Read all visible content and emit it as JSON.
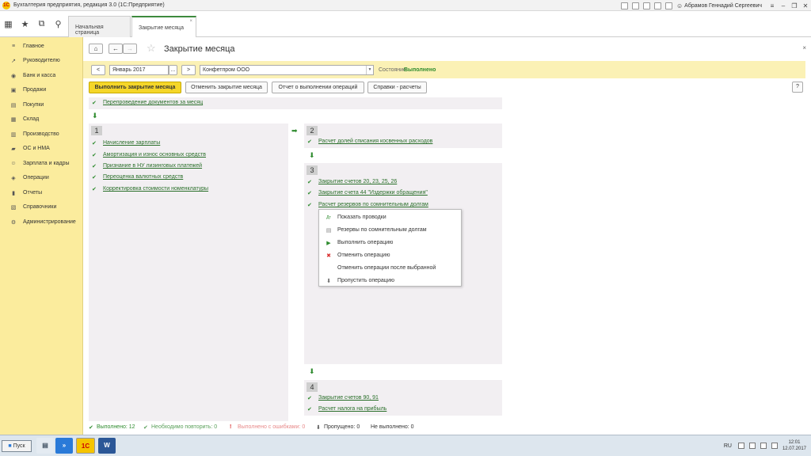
{
  "window": {
    "title": "Бухгалтерия предприятия, редакция 3.0  (1С:Предприятие)",
    "user": "Абрамов Геннадий Сергеевич"
  },
  "tabs": [
    {
      "label": "Начальная страница"
    },
    {
      "label": "Закрытие месяца",
      "close": "×"
    }
  ],
  "sidebar": {
    "items": [
      {
        "label": "Главное",
        "icon": "≡"
      },
      {
        "label": "Руководителю",
        "icon": "↗"
      },
      {
        "label": "Банк и касса",
        "icon": "◉"
      },
      {
        "label": "Продажи",
        "icon": "▣"
      },
      {
        "label": "Покупки",
        "icon": "▤"
      },
      {
        "label": "Склад",
        "icon": "▦"
      },
      {
        "label": "Производство",
        "icon": "▥"
      },
      {
        "label": "ОС и НМА",
        "icon": "▰"
      },
      {
        "label": "Зарплата и кадры",
        "icon": "☺"
      },
      {
        "label": "Операции",
        "icon": "◈"
      },
      {
        "label": "Отчеты",
        "icon": "▮"
      },
      {
        "label": "Справочники",
        "icon": "▧"
      },
      {
        "label": "Администрирование",
        "icon": "⚙"
      }
    ]
  },
  "page": {
    "title": "Закрытие месяца",
    "period": "Январь 2017",
    "organization": "Конфетпром ООО",
    "state_label": "Состояние:",
    "state_value": "Выполнено",
    "prev": "<",
    "next": ">",
    "ellipsis": "...",
    "close": "×",
    "help": "?"
  },
  "commands": {
    "execute": "Выполнить закрытие месяца",
    "cancel": "Отменить закрытие месяца",
    "report": "Отчет о выполнении операций",
    "references": "Справки - расчеты"
  },
  "top_operation": "Перепроведение документов за месяц",
  "stages": {
    "s1": {
      "number": "1",
      "items": [
        "Начисление зарплаты",
        "Амортизация и износ основных средств",
        "Признание в НУ лизинговых платежей",
        "Переоценка валютных средств",
        "Корректировка стоимости номенклатуры"
      ]
    },
    "s2": {
      "number": "2",
      "items": [
        "Расчет долей списания косвенных расходов"
      ]
    },
    "s3": {
      "number": "3",
      "items": [
        "Закрытие счетов 20, 23, 25, 26",
        "Закрытие счета 44 \"Издержки обращения\"",
        "Расчет резервов по сомнительным долгам"
      ]
    },
    "s4": {
      "number": "4",
      "items": [
        "Закрытие счетов 90, 91",
        "Расчет налога на прибыль"
      ]
    }
  },
  "context_menu": {
    "items": [
      {
        "label": "Показать проводки",
        "icon": "Дт"
      },
      {
        "label": "Резервы по сомнительным долгам",
        "icon": "▤"
      },
      {
        "label": "Выполнить операцию",
        "icon": "▶"
      },
      {
        "label": "Отменить операцию",
        "icon": "✖"
      },
      {
        "label": "Отменить операции после выбранной",
        "icon": ""
      },
      {
        "label": "Пропустить операцию",
        "icon": "⬇"
      }
    ]
  },
  "status": {
    "done": "Выполнено: 12",
    "repeat": "Необходимо повторить: 0",
    "errors": "Выполнено с ошибками: 0",
    "skipped": "Пропущено: 0",
    "not_done": "Не выполнено: 0"
  },
  "taskbar": {
    "start": "Пуск",
    "lang": "RU",
    "time": "12:01",
    "date": "12.07.2017"
  },
  "colors": {
    "accent_green": "#2e8b2e",
    "sidebar_bg": "#fbec9d",
    "primary_button": "#f5d629"
  }
}
